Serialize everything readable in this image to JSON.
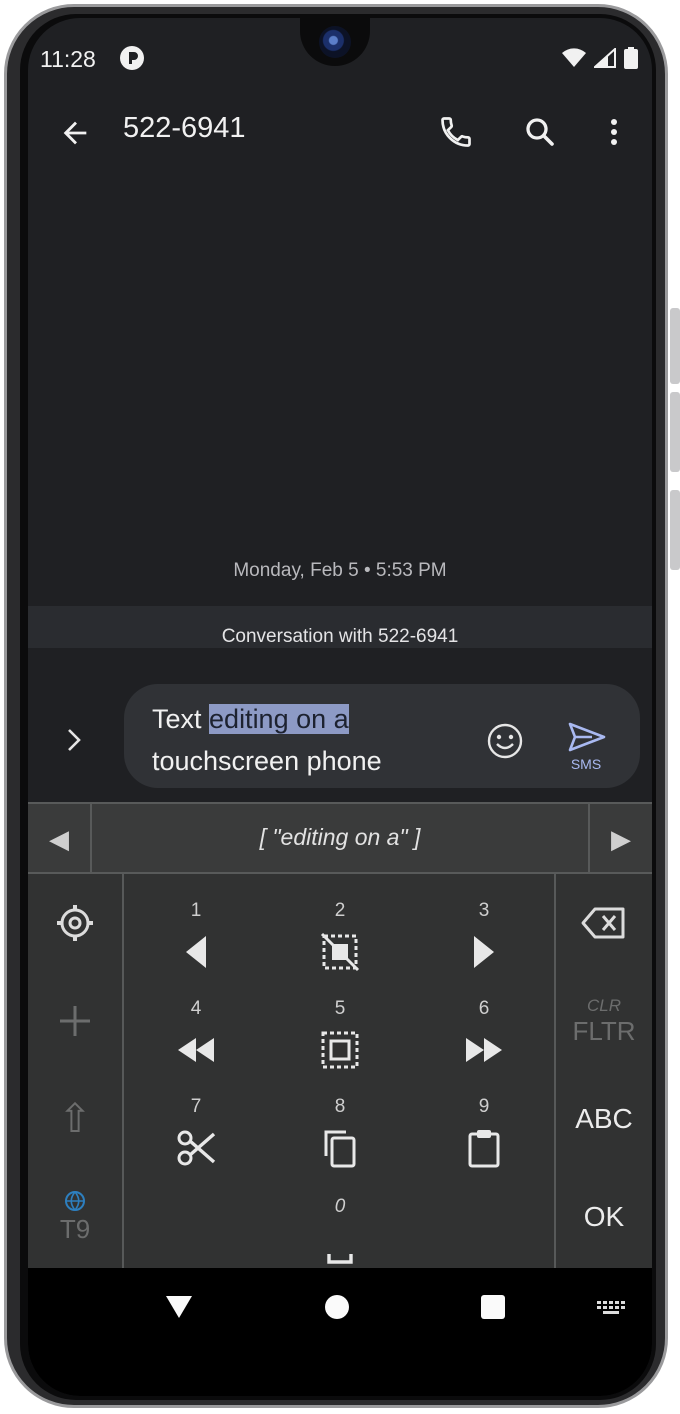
{
  "status_bar": {
    "time": "11:28"
  },
  "app_bar": {
    "title": "522-6941",
    "icons": [
      "back-arrow-icon",
      "phone-icon",
      "search-icon",
      "more-vert-icon"
    ]
  },
  "conversation": {
    "date_stamp": "Monday, Feb 5 • 5:53 PM",
    "header": "Conversation with 522-6941"
  },
  "composer": {
    "text_before": "Text ",
    "text_selected": "editing on a",
    "text_after": " touchscreen phone",
    "send_label": "SMS"
  },
  "keyboard": {
    "suggestion": "[ \"editing on a\" ]",
    "left_arrow": "◀",
    "right_arrow": "▶",
    "keys": [
      {
        "num": "1",
        "icon": "left-arrow-icon"
      },
      {
        "num": "2",
        "icon": "deselect-icon"
      },
      {
        "num": "3",
        "icon": "right-arrow-icon"
      },
      {
        "num": "4",
        "icon": "word-left-icon"
      },
      {
        "num": "5",
        "icon": "select-all-icon"
      },
      {
        "num": "6",
        "icon": "word-right-icon"
      },
      {
        "num": "7",
        "icon": "cut-icon"
      },
      {
        "num": "8",
        "icon": "copy-icon"
      },
      {
        "num": "9",
        "icon": "paste-icon"
      },
      {
        "num": "0",
        "icon": "space-icon"
      }
    ],
    "left_keys": {
      "shift": "⇧",
      "mode": "T9"
    },
    "right_keys": {
      "clr": "CLR",
      "fltr": "FLTR",
      "abc": "ABC",
      "ok": "OK"
    }
  }
}
